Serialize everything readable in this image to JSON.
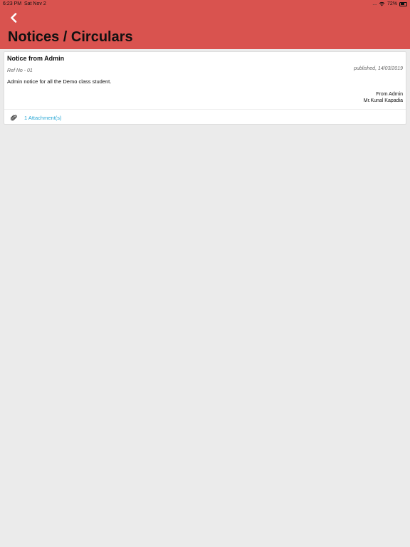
{
  "status_bar": {
    "time": "6:23 PM",
    "date": "Sat Nov 2",
    "battery": "72%",
    "battery_level": 0.72
  },
  "header": {
    "title": "Notices / Circulars",
    "background_color": "#d9534f"
  },
  "notice": {
    "title": "Notice from Admin",
    "ref_no": "Ref No - 01",
    "published": "published, 14/03/2019",
    "body": "Admin notice for all the Demo class student.",
    "from_label": "From Admin",
    "from_name": "Mr.Kunal Kapadia",
    "attachments_label": "1 Attachment(s)",
    "link_color": "#2aa8d6"
  },
  "icons": {
    "back": "chevron-left-icon",
    "attachment": "paperclip-icon",
    "wifi": "wifi-icon",
    "battery": "battery-icon"
  }
}
